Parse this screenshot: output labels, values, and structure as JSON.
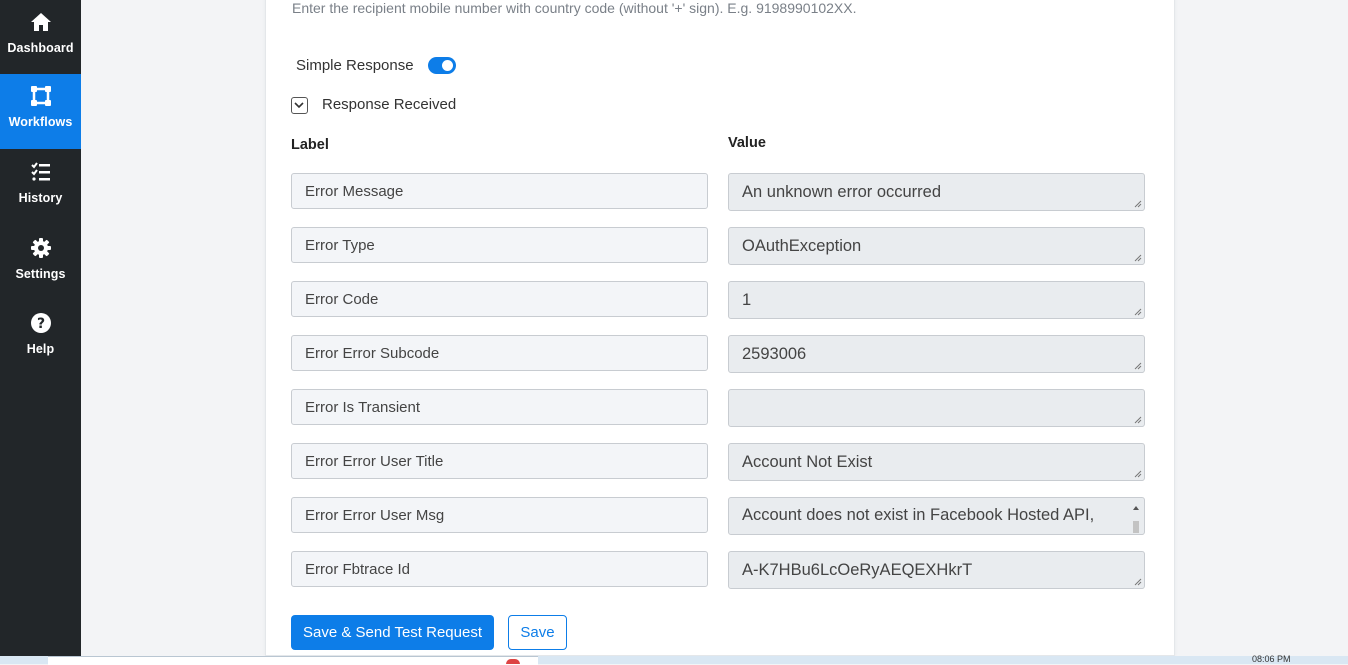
{
  "sidebar": {
    "items": [
      {
        "label": "Dashboard",
        "icon": "home-icon",
        "active": false
      },
      {
        "label": "Workflows",
        "icon": "workflow-icon",
        "active": true
      },
      {
        "label": "History",
        "icon": "list-icon",
        "active": false
      },
      {
        "label": "Settings",
        "icon": "gear-icon",
        "active": false
      },
      {
        "label": "Help",
        "icon": "help-icon",
        "active": false
      }
    ]
  },
  "form": {
    "help_text": "Enter the recipient mobile number with country code (without '+' sign). E.g. 9198990102XX.",
    "simple_response_label": "Simple Response",
    "simple_response_on": true,
    "response_received_label": "Response Received",
    "label_header": "Label",
    "value_header": "Value",
    "rows": [
      {
        "label": "Error Message",
        "value": "An unknown error occurred"
      },
      {
        "label": "Error Type",
        "value": "OAuthException"
      },
      {
        "label": "Error Code",
        "value": "1"
      },
      {
        "label": "Error Error Subcode",
        "value": "2593006"
      },
      {
        "label": "Error Is Transient",
        "value": ""
      },
      {
        "label": "Error Error User Title",
        "value": "Account Not Exist"
      },
      {
        "label": "Error Error User Msg",
        "value": "Account does not exist in Facebook Hosted API,"
      },
      {
        "label": "Error Fbtrace Id",
        "value": "A-K7HBu6LcOeRyAEQEXHkrT"
      }
    ],
    "save_send_label": "Save & Send Test Request",
    "save_label": "Save"
  },
  "taskbar": {
    "time": "08:06 PM"
  },
  "colors": {
    "accent": "#0d7de8",
    "sidebar_bg": "#222629"
  }
}
